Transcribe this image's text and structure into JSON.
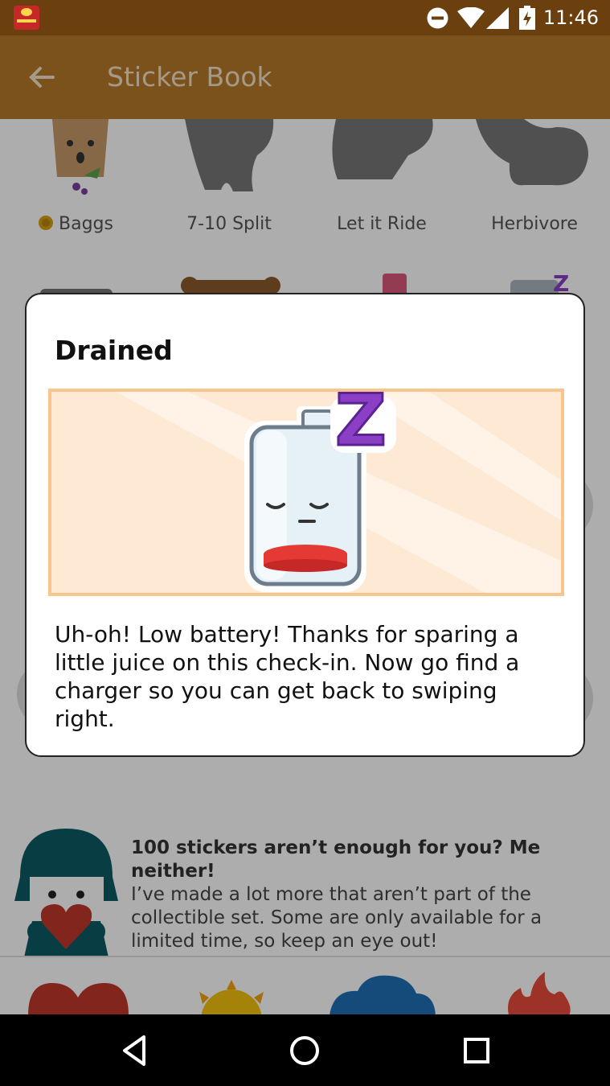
{
  "status_bar": {
    "time": "11:46"
  },
  "app_bar": {
    "title": "Sticker Book"
  },
  "stickers_row1": [
    {
      "label": "Baggs",
      "earned": true
    },
    {
      "label": "7-10 Split",
      "earned": false
    },
    {
      "label": "Let it Ride",
      "earned": false
    },
    {
      "label": "Herbivore",
      "earned": false
    }
  ],
  "dialog": {
    "title": "Drained",
    "body": "Uh-oh! Low battery! Thanks for sparing a little juice on this check-in. Now go find a charger so you can get back to swiping right.",
    "art_letter": "Z"
  },
  "promo": {
    "headline": "100 stickers aren’t enough for you? Me neither!",
    "body": "I’ve made a lot more that aren’t part of the collectible set. Some are only available for a limited time, so keep an eye out!"
  },
  "colors": {
    "status_bar": "#6b3f0e",
    "app_bar": "#b57a2a",
    "art_frame_fill": "#fde9d4",
    "art_frame_border": "#f8c58d",
    "battery_red": "#e53935",
    "z_purple": "#8a3fc4"
  }
}
